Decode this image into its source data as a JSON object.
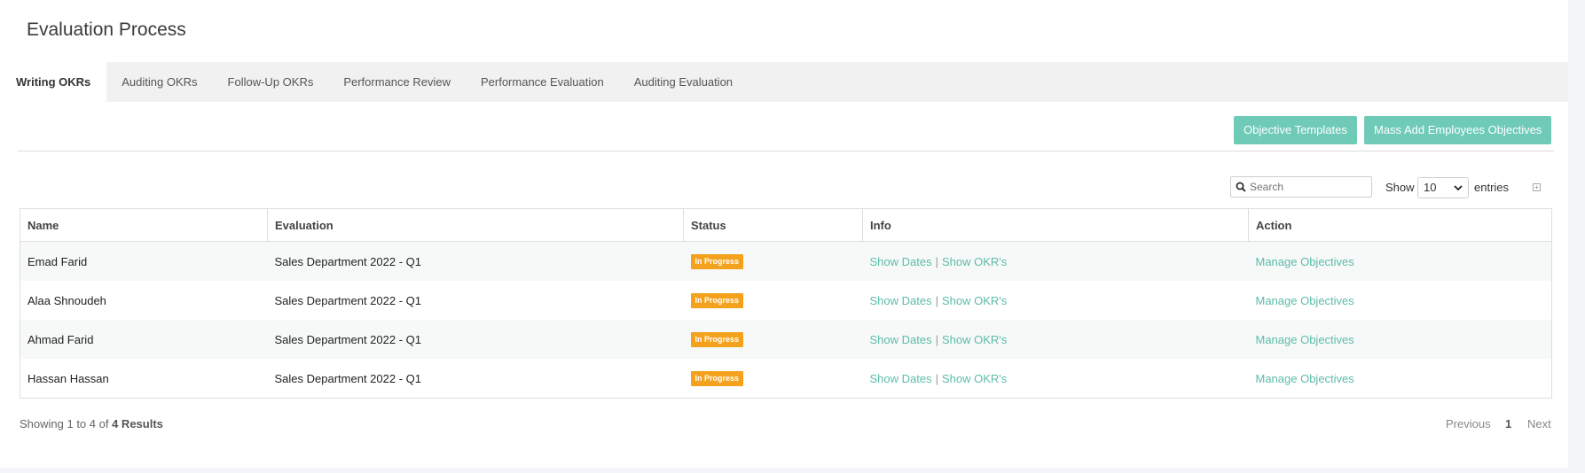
{
  "page": {
    "title": "Evaluation Process"
  },
  "tabs": [
    {
      "label": "Writing OKRs",
      "active": true
    },
    {
      "label": "Auditing OKRs"
    },
    {
      "label": "Follow-Up OKRs"
    },
    {
      "label": "Performance Review"
    },
    {
      "label": "Performance Evaluation"
    },
    {
      "label": "Auditing Evaluation"
    }
  ],
  "actions": {
    "objective_templates": "Objective Templates",
    "mass_add": "Mass Add Employees Objectives"
  },
  "table_controls": {
    "search_placeholder": "Search",
    "show_label": "Show",
    "page_size": "10",
    "entries_label": "entries"
  },
  "table": {
    "columns": [
      "Name",
      "Evaluation",
      "Status",
      "Info",
      "Action"
    ],
    "rows": [
      {
        "name": "Emad Farid",
        "evaluation": "Sales Department 2022 - Q1",
        "status": "In Progress",
        "show_dates": "Show Dates",
        "show_okrs": "Show OKR's",
        "action": "Manage Objectives"
      },
      {
        "name": "Alaa Shnoudeh",
        "evaluation": "Sales Department 2022 - Q1",
        "status": "In Progress",
        "show_dates": "Show Dates",
        "show_okrs": "Show OKR's",
        "action": "Manage Objectives"
      },
      {
        "name": "Ahmad Farid",
        "evaluation": "Sales Department 2022 - Q1",
        "status": "In Progress",
        "show_dates": "Show Dates",
        "show_okrs": "Show OKR's",
        "action": "Manage Objectives"
      },
      {
        "name": "Hassan Hassan",
        "evaluation": "Sales Department 2022 - Q1",
        "status": "In Progress",
        "show_dates": "Show Dates",
        "show_okrs": "Show OKR's",
        "action": "Manage Objectives"
      }
    ]
  },
  "footer": {
    "showing_prefix": "Showing 1 to 4 of",
    "results": "4 Results",
    "previous": "Previous",
    "current_page": "1",
    "next": "Next"
  },
  "colors": {
    "accent": "#6fcab8",
    "link": "#5cbca8",
    "status_in_progress": "#f4a21e"
  }
}
